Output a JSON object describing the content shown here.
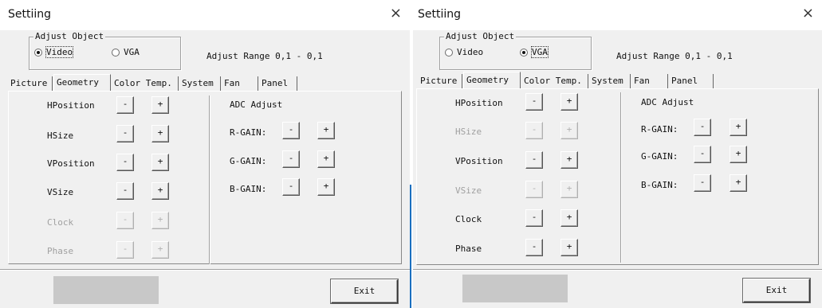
{
  "windows": [
    {
      "title": "Settiing",
      "close_symbol": "×",
      "adjust_object": {
        "label": "Adjust Object",
        "options": [
          {
            "label": "Video",
            "selected": true
          },
          {
            "label": "VGA",
            "selected": false
          }
        ]
      },
      "adjust_range": "Adjust Range 0,1 - 0,1",
      "tabs": [
        {
          "label": "Picture",
          "active": false
        },
        {
          "label": "Geometry",
          "active": true
        },
        {
          "label": "Color Temp.",
          "active": false
        },
        {
          "label": "System",
          "active": false
        },
        {
          "label": "Fan",
          "active": false
        },
        {
          "label": "Panel",
          "active": false
        }
      ],
      "geometry_rows": [
        {
          "label": "HPosition",
          "enabled": true,
          "minus": "-",
          "plus": "+"
        },
        {
          "label": "HSize",
          "enabled": true,
          "minus": "-",
          "plus": "+"
        },
        {
          "label": "VPosition",
          "enabled": true,
          "minus": "-",
          "plus": "+"
        },
        {
          "label": "VSize",
          "enabled": true,
          "minus": "-",
          "plus": "+"
        },
        {
          "label": "Clock",
          "enabled": false,
          "minus": "-",
          "plus": "+"
        },
        {
          "label": "Phase",
          "enabled": false,
          "minus": "-",
          "plus": "+"
        }
      ],
      "adc": {
        "title": "ADC Adjust",
        "rows": [
          {
            "label": "R-GAIN:",
            "minus": "-",
            "plus": "+"
          },
          {
            "label": "G-GAIN:",
            "minus": "-",
            "plus": "+"
          },
          {
            "label": "B-GAIN:",
            "minus": "-",
            "plus": "+"
          }
        ]
      },
      "exit_label": "Exit"
    },
    {
      "title": "Settiing",
      "close_symbol": "×",
      "adjust_object": {
        "label": "Adjust Object",
        "options": [
          {
            "label": "Video",
            "selected": false
          },
          {
            "label": "VGA",
            "selected": true
          }
        ]
      },
      "adjust_range": "Adjust Range 0,1 - 0,1",
      "tabs": [
        {
          "label": "Picture",
          "active": false
        },
        {
          "label": "Geometry",
          "active": true
        },
        {
          "label": "Color Temp.",
          "active": false
        },
        {
          "label": "System",
          "active": false
        },
        {
          "label": "Fan",
          "active": false
        },
        {
          "label": "Panel",
          "active": false
        }
      ],
      "geometry_rows": [
        {
          "label": "HPosition",
          "enabled": true,
          "minus": "-",
          "plus": "+"
        },
        {
          "label": "HSize",
          "enabled": false,
          "minus": "-",
          "plus": "+"
        },
        {
          "label": "VPosition",
          "enabled": true,
          "minus": "-",
          "plus": "+"
        },
        {
          "label": "VSize",
          "enabled": false,
          "minus": "-",
          "plus": "+"
        },
        {
          "label": "Clock",
          "enabled": true,
          "minus": "-",
          "plus": "+"
        },
        {
          "label": "Phase",
          "enabled": true,
          "minus": "-",
          "plus": "+"
        }
      ],
      "adc": {
        "title": "ADC Adjust",
        "rows": [
          {
            "label": "R-GAIN:",
            "minus": "-",
            "plus": "+"
          },
          {
            "label": "G-GAIN:",
            "minus": "-",
            "plus": "+"
          },
          {
            "label": "B-GAIN:",
            "minus": "-",
            "plus": "+"
          }
        ]
      },
      "exit_label": "Exit"
    }
  ]
}
